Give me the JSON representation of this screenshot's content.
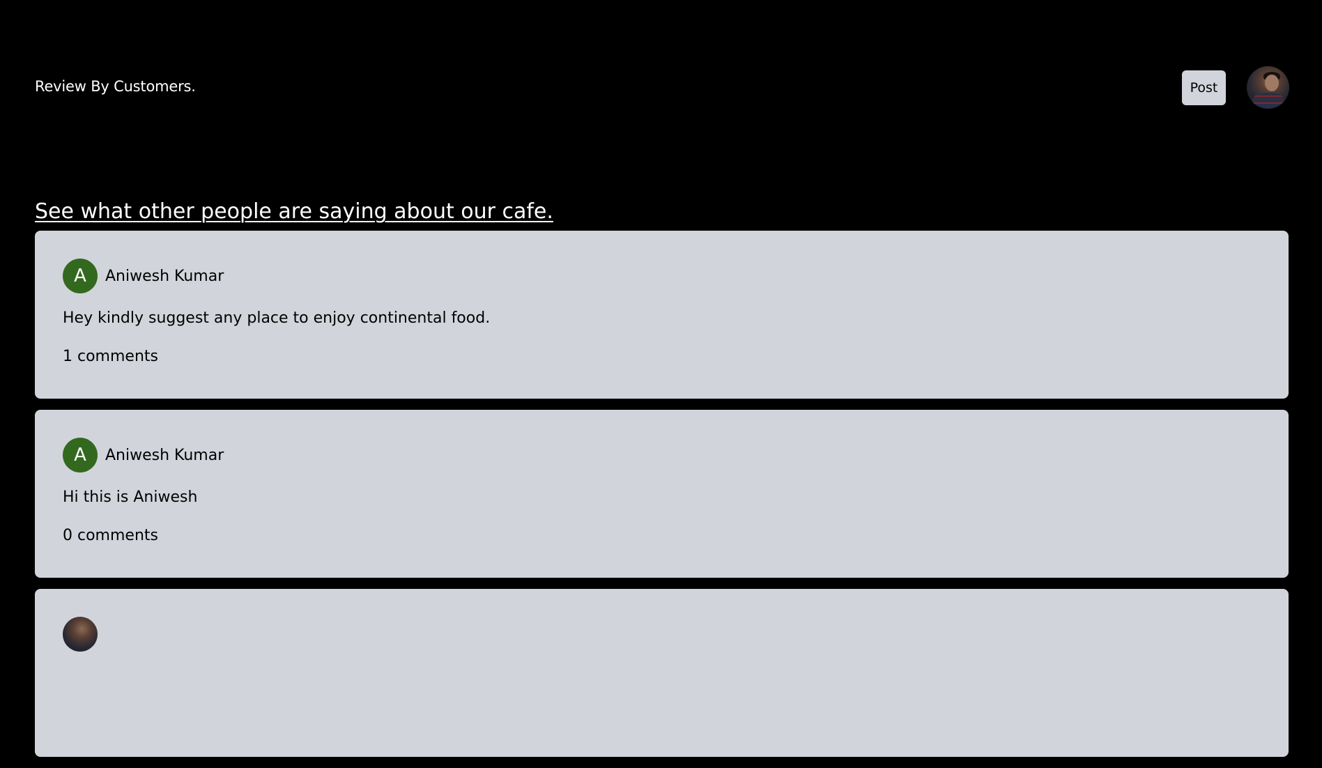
{
  "header": {
    "brand": "Review By Customers.",
    "post_label": "Post",
    "profile_icon": "user-profile-photo"
  },
  "main": {
    "headline": "See what other people are saying about our cafe."
  },
  "posts": [
    {
      "avatar_letter": "A",
      "avatar_color": "#33691e",
      "author": "Aniwesh Kumar",
      "message": "Hey kindly suggest any place to enjoy continental food.",
      "comments": "1 comments"
    },
    {
      "avatar_letter": "A",
      "avatar_color": "#33691e",
      "author": "Aniwesh Kumar",
      "message": "Hi this is Aniwesh",
      "comments": "0 comments"
    },
    {
      "avatar_type": "photo"
    }
  ],
  "colors": {
    "background": "#000000",
    "card": "#d1d5db",
    "button": "#d1d5db",
    "avatar_green": "#33691e"
  }
}
